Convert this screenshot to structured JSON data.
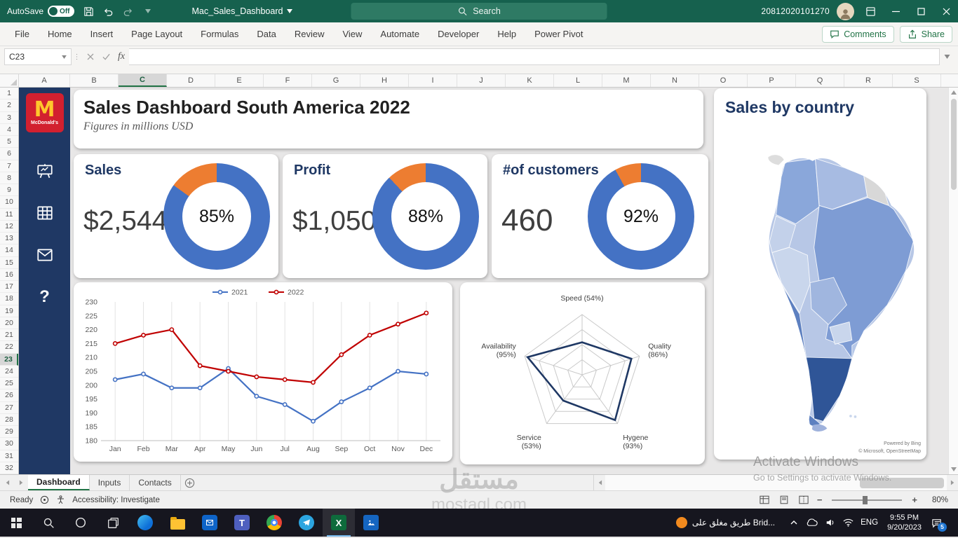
{
  "titlebar": {
    "autosave_label": "AutoSave",
    "autosave_state": "Off",
    "filename": "Mac_Sales_Dashboard",
    "search_label": "Search",
    "user_id": "20812020101270"
  },
  "ribbon": {
    "tabs": [
      "File",
      "Home",
      "Insert",
      "Page Layout",
      "Formulas",
      "Data",
      "Review",
      "View",
      "Automate",
      "Developer",
      "Help",
      "Power Pivot"
    ],
    "comments_label": "Comments",
    "share_label": "Share"
  },
  "formula_bar": {
    "name_box": "C23",
    "fx_label": "fx",
    "formula": ""
  },
  "grid": {
    "columns": [
      "A",
      "B",
      "C",
      "D",
      "E",
      "F",
      "G",
      "H",
      "I",
      "J",
      "K",
      "L",
      "M",
      "N",
      "O",
      "P",
      "Q",
      "R",
      "S"
    ],
    "selected_column": "C",
    "rows": [
      1,
      2,
      3,
      4,
      5,
      6,
      7,
      8,
      9,
      10,
      11,
      12,
      13,
      14,
      15,
      16,
      17,
      18,
      19,
      20,
      21,
      22,
      23,
      24,
      25,
      26,
      27,
      28,
      29,
      30,
      31,
      32
    ],
    "selected_row": 23
  },
  "sidebar": {
    "brand": "McDonald's",
    "logo_letter": "M",
    "icons": [
      "presentation-icon",
      "table-icon",
      "mail-icon",
      "help-icon"
    ],
    "navy_color": "#1F3864",
    "logo_red": "#D2202F",
    "logo_gold": "#FFC72C"
  },
  "dashboard": {
    "title": "Sales Dashboard South America 2022",
    "subtitle": "Figures in millions USD",
    "map": {
      "title": "Sales by country",
      "credit1": "Powered by Bing",
      "credit2": "© Microsoft, OpenStreetMap",
      "palette": [
        "#D8D8D8",
        "#C9D6EC",
        "#A7BBE2",
        "#7E9CD4",
        "#5D80C0",
        "#2F5597"
      ]
    }
  },
  "chart_data": [
    {
      "type": "donut",
      "main_color": "#4472C4",
      "accent_color": "#ED7D31",
      "items": [
        {
          "label": "Sales",
          "value": "$2,544",
          "percent": 85,
          "percent_label": "85%"
        },
        {
          "label": "Profit",
          "value": "$1,050",
          "percent": 88,
          "percent_label": "88%"
        },
        {
          "label": "#of customers",
          "value": "460",
          "percent": 92,
          "percent_label": "92%"
        }
      ]
    },
    {
      "type": "line",
      "categories": [
        "Jan",
        "Feb",
        "Mar",
        "Apr",
        "May",
        "Jun",
        "Jul",
        "Aug",
        "Sep",
        "Oct",
        "Nov",
        "Dec"
      ],
      "series": [
        {
          "name": "2021",
          "color": "#4472C4",
          "values": [
            202,
            204,
            199,
            199,
            206,
            196,
            193,
            187,
            194,
            199,
            205,
            204
          ]
        },
        {
          "name": "2022",
          "color": "#C00000",
          "values": [
            215,
            218,
            220,
            207,
            205,
            203,
            202,
            201,
            211,
            218,
            222,
            226
          ]
        }
      ],
      "ylim": [
        180,
        230
      ],
      "ytick_step": 5,
      "grid": "vertical",
      "legend_position": "top"
    },
    {
      "type": "radar",
      "categories": [
        "Speed",
        "Quality",
        "Hygene",
        "Service",
        "Availability"
      ],
      "values": [
        54,
        86,
        93,
        53,
        95
      ],
      "max": 100,
      "color": "#1F3864",
      "label_lines": [
        [
          "Speed (54%)"
        ],
        [
          "Quality",
          "(86%)"
        ],
        [
          "Hygene",
          "(93%)"
        ],
        [
          "Service",
          "(53%)"
        ],
        [
          "Availability",
          "(95%)"
        ]
      ]
    }
  ],
  "sheet_tabs": {
    "tabs": [
      {
        "label": "Dashboard",
        "active": true
      },
      {
        "label": "Inputs",
        "active": false
      },
      {
        "label": "Contacts",
        "active": false
      }
    ]
  },
  "status_bar": {
    "ready_label": "Ready",
    "accessibility_label": "Accessibility: Investigate",
    "zoom_label": "80%"
  },
  "taskbar": {
    "icons": [
      "start",
      "search",
      "cortana",
      "task-view",
      "edge",
      "file-explorer",
      "mail",
      "teams",
      "chrome",
      "telegram",
      "excel",
      "photos"
    ],
    "active_icon": "excel",
    "toast_text": "طريق مغلق على Brid...",
    "language": "ENG",
    "time": "9:55 PM",
    "date": "9/20/2023",
    "badge": "5"
  },
  "watermark": {
    "line1": "مستقل",
    "line2": "mostaql.com"
  },
  "activate": {
    "line1": "Activate Windows",
    "line2": "Go to Settings to activate Windows."
  },
  "colors": {
    "titlebar_green": "#16614E",
    "accent_green": "#217346",
    "donut_blue": "#4472C4",
    "donut_orange": "#ED7D31"
  }
}
